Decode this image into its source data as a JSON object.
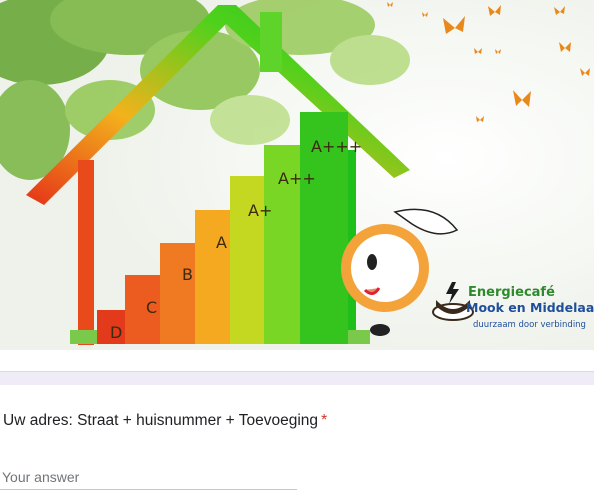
{
  "banner": {
    "energy_labels": [
      "D",
      "C",
      "B",
      "A",
      "A+",
      "A++",
      "A+++"
    ],
    "logo": {
      "line1": "Energiecafé",
      "line2": "Mook en Middelaar",
      "tagline": "duurzaam door verbinding"
    }
  },
  "question": {
    "title": "Uw adres:  Straat + huisnummer + Toevoeging",
    "required_mark": "*",
    "placeholder": "Your answer",
    "value": ""
  },
  "colors": {
    "required": "#d93025",
    "divider": "#f0ecf7",
    "logo_green": "#2f8a2e",
    "logo_blue": "#1f4e9a"
  }
}
